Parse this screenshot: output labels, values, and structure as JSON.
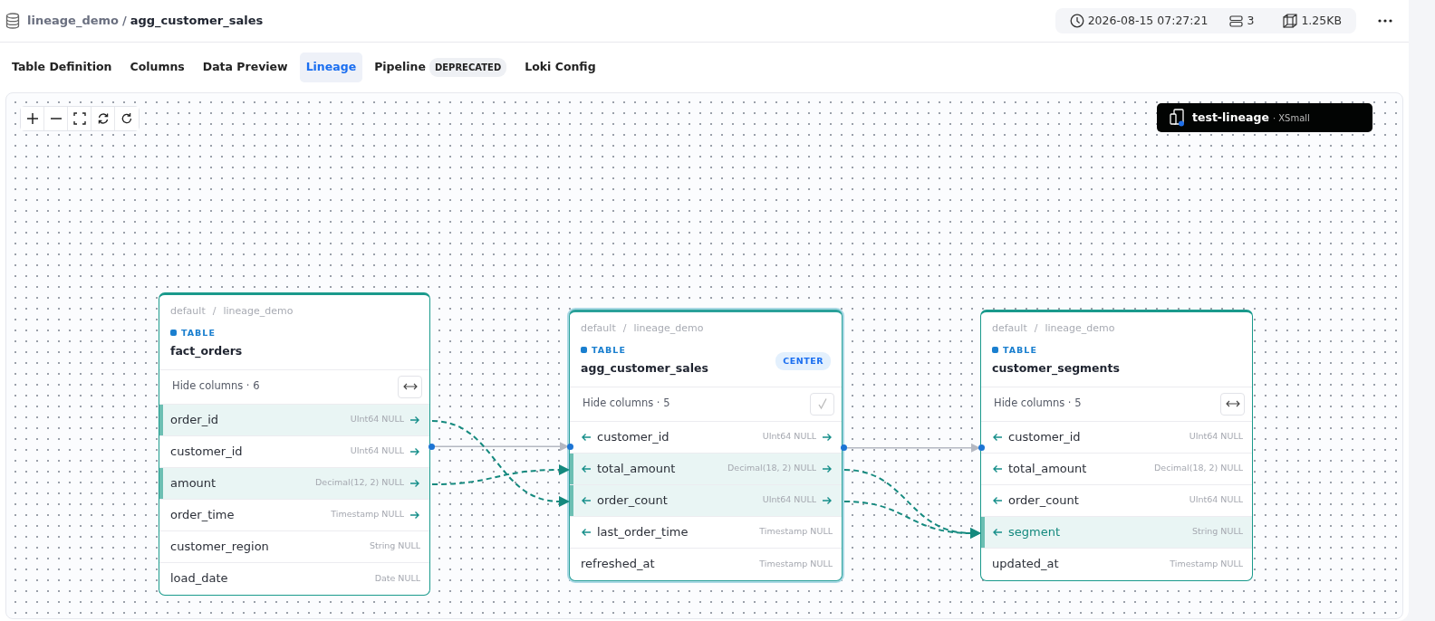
{
  "breadcrumb": {
    "database": "lineage_demo",
    "separator": "/",
    "table": "agg_customer_sales"
  },
  "stats": {
    "updated": "2026-08-15 07:27:21",
    "parts": "3",
    "size": "1.25KB"
  },
  "tabs": [
    {
      "label": "Table Definition",
      "selected": false
    },
    {
      "label": "Columns",
      "selected": false
    },
    {
      "label": "Data Preview",
      "selected": false
    },
    {
      "label": "Lineage",
      "selected": true
    },
    {
      "label": "Pipeline",
      "selected": false,
      "badge": "DEPRECATED"
    },
    {
      "label": "Loki Config",
      "selected": false
    }
  ],
  "warehouse": {
    "name": "test-lineage",
    "size": "· XSmall"
  },
  "nodes": [
    {
      "kind": "upstream",
      "catalog": "default",
      "separator": "/",
      "database": "lineage_demo",
      "type": "TABLE",
      "name": "fact_orders",
      "hide_label": "Hide columns · 6",
      "columns": [
        {
          "name": "order_id",
          "type": "UInt64 NULL",
          "incoming": false,
          "outgoing": true,
          "highlighted": true,
          "selected": false
        },
        {
          "name": "customer_id",
          "type": "UInt64 NULL",
          "incoming": false,
          "outgoing": true,
          "highlighted": false,
          "selected": false
        },
        {
          "name": "amount",
          "type": "Decimal(12, 2) NULL",
          "incoming": false,
          "outgoing": true,
          "highlighted": true,
          "selected": false
        },
        {
          "name": "order_time",
          "type": "Timestamp NULL",
          "incoming": false,
          "outgoing": true,
          "highlighted": false,
          "selected": false
        },
        {
          "name": "customer_region",
          "type": "String NULL",
          "incoming": false,
          "outgoing": false,
          "highlighted": false,
          "selected": false
        },
        {
          "name": "load_date",
          "type": "Date NULL",
          "incoming": false,
          "outgoing": false,
          "highlighted": false,
          "selected": false
        }
      ]
    },
    {
      "kind": "center",
      "catalog": "default",
      "separator": "/",
      "database": "lineage_demo",
      "type": "TABLE",
      "name": "agg_customer_sales",
      "badge": "CENTER",
      "hide_label": "Hide columns · 5",
      "columns": [
        {
          "name": "customer_id",
          "type": "UInt64 NULL",
          "incoming": true,
          "outgoing": true,
          "highlighted": false,
          "selected": false
        },
        {
          "name": "total_amount",
          "type": "Decimal(18, 2) NULL",
          "incoming": true,
          "outgoing": true,
          "highlighted": true,
          "selected": false
        },
        {
          "name": "order_count",
          "type": "UInt64 NULL",
          "incoming": true,
          "outgoing": true,
          "highlighted": true,
          "selected": false
        },
        {
          "name": "last_order_time",
          "type": "Timestamp NULL",
          "incoming": true,
          "outgoing": false,
          "highlighted": false,
          "selected": false
        },
        {
          "name": "refreshed_at",
          "type": "Timestamp NULL",
          "incoming": false,
          "outgoing": false,
          "highlighted": false,
          "selected": false
        }
      ]
    },
    {
      "kind": "downstream",
      "catalog": "default",
      "separator": "/",
      "database": "lineage_demo",
      "type": "TABLE",
      "name": "customer_segments",
      "hide_label": "Hide columns · 5",
      "columns": [
        {
          "name": "customer_id",
          "type": "UInt64 NULL",
          "incoming": true,
          "outgoing": false,
          "highlighted": false,
          "selected": false
        },
        {
          "name": "total_amount",
          "type": "Decimal(18, 2) NULL",
          "incoming": true,
          "outgoing": false,
          "highlighted": false,
          "selected": false
        },
        {
          "name": "order_count",
          "type": "UInt64 NULL",
          "incoming": true,
          "outgoing": false,
          "highlighted": false,
          "selected": false
        },
        {
          "name": "segment",
          "type": "String NULL",
          "incoming": true,
          "outgoing": false,
          "highlighted": true,
          "selected": true
        },
        {
          "name": "updated_at",
          "type": "Timestamp NULL",
          "incoming": false,
          "outgoing": false,
          "highlighted": false,
          "selected": false
        }
      ]
    }
  ]
}
